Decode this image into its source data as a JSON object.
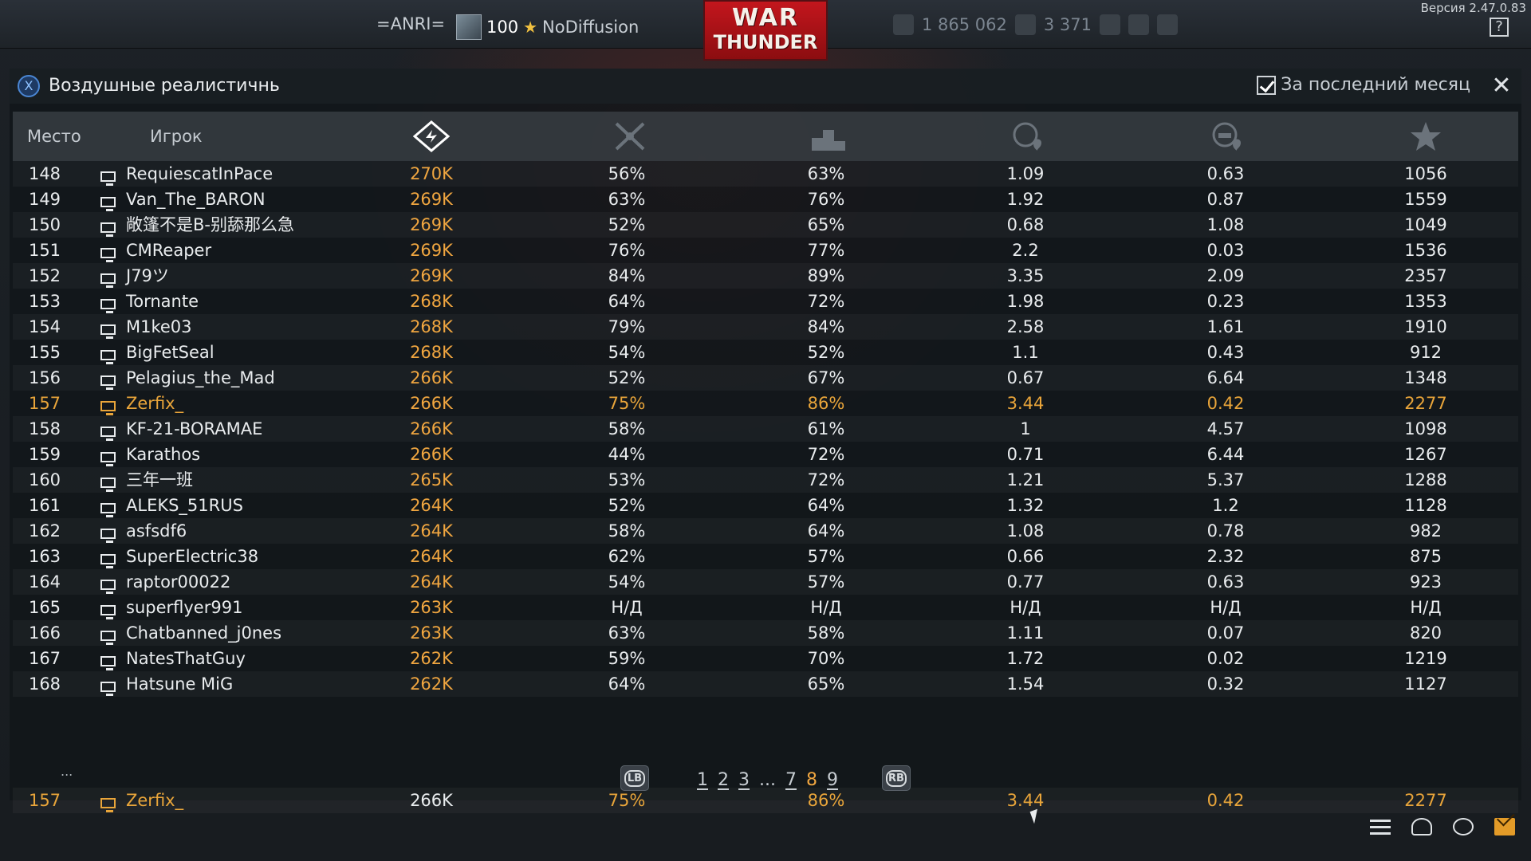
{
  "topbar": {
    "squadron": "=ANRI=",
    "level": "100",
    "nickname": "NoDiffusion",
    "logo_line1": "WAR",
    "logo_line2": "THUNDER",
    "silver_lions": "1 865 062",
    "golden_eagles": "3 371",
    "version": "Версия 2.47.0.83",
    "help_label": "?"
  },
  "window": {
    "mode_badge": "X",
    "mode_title": "Воздушные реалистичные бо",
    "month_filter_label": "За последний месяц",
    "month_filter_checked": true,
    "close_label": "✕"
  },
  "table": {
    "headers": {
      "place": "Место",
      "player": "Игрок"
    },
    "header_icons": [
      "rating-icon",
      "crossed-swords-icon",
      "podium-icon",
      "air-kills-icon",
      "ground-kills-icon",
      "star-icon"
    ],
    "rows": [
      {
        "place": "148",
        "name": "RequiescatInPace",
        "score": "270K",
        "win": "56%",
        "top": "63%",
        "kd": "1.09",
        "gk": "0.63",
        "rating": "1056"
      },
      {
        "place": "149",
        "name": "Van_The_BARON",
        "score": "269K",
        "win": "63%",
        "top": "76%",
        "kd": "1.92",
        "gk": "0.87",
        "rating": "1559"
      },
      {
        "place": "150",
        "name": "敞篷不是B-别舔那么急",
        "score": "269K",
        "win": "52%",
        "top": "65%",
        "kd": "0.68",
        "gk": "1.08",
        "rating": "1049"
      },
      {
        "place": "151",
        "name": "CMReaper",
        "score": "269K",
        "win": "76%",
        "top": "77%",
        "kd": "2.2",
        "gk": "0.03",
        "rating": "1536"
      },
      {
        "place": "152",
        "name": "J79ツ",
        "score": "269K",
        "win": "84%",
        "top": "89%",
        "kd": "3.35",
        "gk": "2.09",
        "rating": "2357"
      },
      {
        "place": "153",
        "name": "Tornante",
        "score": "268K",
        "win": "64%",
        "top": "72%",
        "kd": "1.98",
        "gk": "0.23",
        "rating": "1353"
      },
      {
        "place": "154",
        "name": "M1ke03",
        "score": "268K",
        "win": "79%",
        "top": "84%",
        "kd": "2.58",
        "gk": "1.61",
        "rating": "1910"
      },
      {
        "place": "155",
        "name": "BigFetSeal",
        "score": "268K",
        "win": "54%",
        "top": "52%",
        "kd": "1.1",
        "gk": "0.43",
        "rating": "912"
      },
      {
        "place": "156",
        "name": "Pelagius_the_Mad",
        "score": "266K",
        "win": "52%",
        "top": "67%",
        "kd": "0.67",
        "gk": "6.64",
        "rating": "1348"
      },
      {
        "place": "157",
        "name": "Zerfix_",
        "score": "266K",
        "win": "75%",
        "top": "86%",
        "kd": "3.44",
        "gk": "0.42",
        "rating": "2277",
        "me": true
      },
      {
        "place": "158",
        "name": "KF-21-BORAMAE",
        "score": "266K",
        "win": "58%",
        "top": "61%",
        "kd": "1",
        "gk": "4.57",
        "rating": "1098"
      },
      {
        "place": "159",
        "name": "Karathos",
        "score": "266K",
        "win": "44%",
        "top": "72%",
        "kd": "0.71",
        "gk": "6.44",
        "rating": "1267"
      },
      {
        "place": "160",
        "name": "三年一班",
        "score": "265K",
        "win": "53%",
        "top": "72%",
        "kd": "1.21",
        "gk": "5.37",
        "rating": "1288"
      },
      {
        "place": "161",
        "name": "ALEKS_51RUS",
        "score": "264K",
        "win": "52%",
        "top": "64%",
        "kd": "1.32",
        "gk": "1.2",
        "rating": "1128"
      },
      {
        "place": "162",
        "name": "asfsdf6",
        "score": "264K",
        "win": "58%",
        "top": "64%",
        "kd": "1.08",
        "gk": "0.78",
        "rating": "982"
      },
      {
        "place": "163",
        "name": "SuperElectric38",
        "score": "264K",
        "win": "62%",
        "top": "57%",
        "kd": "0.66",
        "gk": "2.32",
        "rating": "875"
      },
      {
        "place": "164",
        "name": "raptor00022",
        "score": "264K",
        "win": "54%",
        "top": "57%",
        "kd": "0.77",
        "gk": "0.63",
        "rating": "923"
      },
      {
        "place": "165",
        "name": "superflyer991",
        "score": "263K",
        "win": "Н/Д",
        "top": "Н/Д",
        "kd": "Н/Д",
        "gk": "Н/Д",
        "rating": "Н/Д"
      },
      {
        "place": "166",
        "name": "Chatbanned_j0nes",
        "score": "263K",
        "win": "63%",
        "top": "58%",
        "kd": "1.11",
        "gk": "0.07",
        "rating": "820"
      },
      {
        "place": "167",
        "name": "NatesThatGuy",
        "score": "262K",
        "win": "59%",
        "top": "70%",
        "kd": "1.72",
        "gk": "0.02",
        "rating": "1219"
      },
      {
        "place": "168",
        "name": "Hatsune MiG",
        "score": "262K",
        "win": "64%",
        "top": "65%",
        "kd": "1.54",
        "gk": "0.32",
        "rating": "1127"
      }
    ],
    "ellipsis": "...",
    "my_row": {
      "place": "157",
      "name": "Zerfix_",
      "score": "266K",
      "win": "75%",
      "top": "86%",
      "kd": "3.44",
      "gk": "0.42",
      "rating": "2277"
    }
  },
  "pager": {
    "prev_label": "LB",
    "next_label": "RB",
    "pages": [
      "1",
      "2",
      "3",
      "...",
      "7",
      "8",
      "9"
    ],
    "active_page": "8"
  },
  "colors": {
    "accent": "#f0a640",
    "highlight_row": "#e9a53a",
    "logo_red": "#c3161d"
  },
  "bottom_icons": [
    "list-icon",
    "friends-icon",
    "chat-icon",
    "mail-icon"
  ]
}
